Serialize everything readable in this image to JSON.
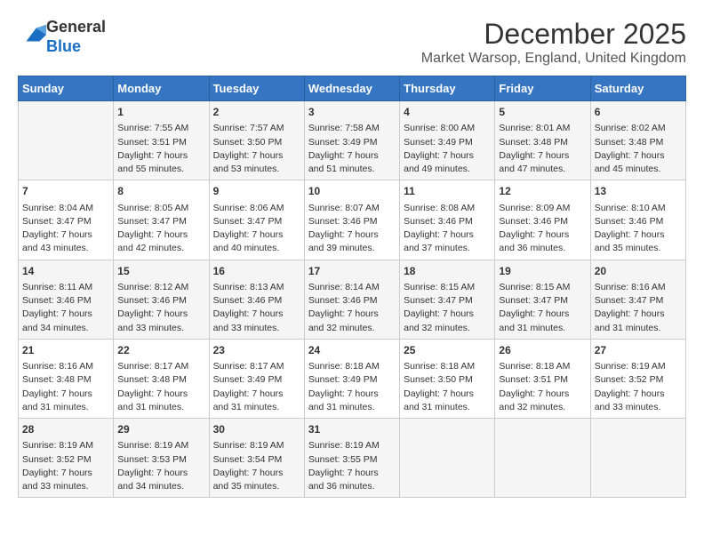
{
  "header": {
    "logo_line1": "General",
    "logo_line2": "Blue",
    "month_year": "December 2025",
    "location": "Market Warsop, England, United Kingdom"
  },
  "days_of_week": [
    "Sunday",
    "Monday",
    "Tuesday",
    "Wednesday",
    "Thursday",
    "Friday",
    "Saturday"
  ],
  "weeks": [
    [
      {
        "day": "",
        "content": ""
      },
      {
        "day": "1",
        "content": "Sunrise: 7:55 AM\nSunset: 3:51 PM\nDaylight: 7 hours\nand 55 minutes."
      },
      {
        "day": "2",
        "content": "Sunrise: 7:57 AM\nSunset: 3:50 PM\nDaylight: 7 hours\nand 53 minutes."
      },
      {
        "day": "3",
        "content": "Sunrise: 7:58 AM\nSunset: 3:49 PM\nDaylight: 7 hours\nand 51 minutes."
      },
      {
        "day": "4",
        "content": "Sunrise: 8:00 AM\nSunset: 3:49 PM\nDaylight: 7 hours\nand 49 minutes."
      },
      {
        "day": "5",
        "content": "Sunrise: 8:01 AM\nSunset: 3:48 PM\nDaylight: 7 hours\nand 47 minutes."
      },
      {
        "day": "6",
        "content": "Sunrise: 8:02 AM\nSunset: 3:48 PM\nDaylight: 7 hours\nand 45 minutes."
      }
    ],
    [
      {
        "day": "7",
        "content": "Sunrise: 8:04 AM\nSunset: 3:47 PM\nDaylight: 7 hours\nand 43 minutes."
      },
      {
        "day": "8",
        "content": "Sunrise: 8:05 AM\nSunset: 3:47 PM\nDaylight: 7 hours\nand 42 minutes."
      },
      {
        "day": "9",
        "content": "Sunrise: 8:06 AM\nSunset: 3:47 PM\nDaylight: 7 hours\nand 40 minutes."
      },
      {
        "day": "10",
        "content": "Sunrise: 8:07 AM\nSunset: 3:46 PM\nDaylight: 7 hours\nand 39 minutes."
      },
      {
        "day": "11",
        "content": "Sunrise: 8:08 AM\nSunset: 3:46 PM\nDaylight: 7 hours\nand 37 minutes."
      },
      {
        "day": "12",
        "content": "Sunrise: 8:09 AM\nSunset: 3:46 PM\nDaylight: 7 hours\nand 36 minutes."
      },
      {
        "day": "13",
        "content": "Sunrise: 8:10 AM\nSunset: 3:46 PM\nDaylight: 7 hours\nand 35 minutes."
      }
    ],
    [
      {
        "day": "14",
        "content": "Sunrise: 8:11 AM\nSunset: 3:46 PM\nDaylight: 7 hours\nand 34 minutes."
      },
      {
        "day": "15",
        "content": "Sunrise: 8:12 AM\nSunset: 3:46 PM\nDaylight: 7 hours\nand 33 minutes."
      },
      {
        "day": "16",
        "content": "Sunrise: 8:13 AM\nSunset: 3:46 PM\nDaylight: 7 hours\nand 33 minutes."
      },
      {
        "day": "17",
        "content": "Sunrise: 8:14 AM\nSunset: 3:46 PM\nDaylight: 7 hours\nand 32 minutes."
      },
      {
        "day": "18",
        "content": "Sunrise: 8:15 AM\nSunset: 3:47 PM\nDaylight: 7 hours\nand 32 minutes."
      },
      {
        "day": "19",
        "content": "Sunrise: 8:15 AM\nSunset: 3:47 PM\nDaylight: 7 hours\nand 31 minutes."
      },
      {
        "day": "20",
        "content": "Sunrise: 8:16 AM\nSunset: 3:47 PM\nDaylight: 7 hours\nand 31 minutes."
      }
    ],
    [
      {
        "day": "21",
        "content": "Sunrise: 8:16 AM\nSunset: 3:48 PM\nDaylight: 7 hours\nand 31 minutes."
      },
      {
        "day": "22",
        "content": "Sunrise: 8:17 AM\nSunset: 3:48 PM\nDaylight: 7 hours\nand 31 minutes."
      },
      {
        "day": "23",
        "content": "Sunrise: 8:17 AM\nSunset: 3:49 PM\nDaylight: 7 hours\nand 31 minutes."
      },
      {
        "day": "24",
        "content": "Sunrise: 8:18 AM\nSunset: 3:49 PM\nDaylight: 7 hours\nand 31 minutes."
      },
      {
        "day": "25",
        "content": "Sunrise: 8:18 AM\nSunset: 3:50 PM\nDaylight: 7 hours\nand 31 minutes."
      },
      {
        "day": "26",
        "content": "Sunrise: 8:18 AM\nSunset: 3:51 PM\nDaylight: 7 hours\nand 32 minutes."
      },
      {
        "day": "27",
        "content": "Sunrise: 8:19 AM\nSunset: 3:52 PM\nDaylight: 7 hours\nand 33 minutes."
      }
    ],
    [
      {
        "day": "28",
        "content": "Sunrise: 8:19 AM\nSunset: 3:52 PM\nDaylight: 7 hours\nand 33 minutes."
      },
      {
        "day": "29",
        "content": "Sunrise: 8:19 AM\nSunset: 3:53 PM\nDaylight: 7 hours\nand 34 minutes."
      },
      {
        "day": "30",
        "content": "Sunrise: 8:19 AM\nSunset: 3:54 PM\nDaylight: 7 hours\nand 35 minutes."
      },
      {
        "day": "31",
        "content": "Sunrise: 8:19 AM\nSunset: 3:55 PM\nDaylight: 7 hours\nand 36 minutes."
      },
      {
        "day": "",
        "content": ""
      },
      {
        "day": "",
        "content": ""
      },
      {
        "day": "",
        "content": ""
      }
    ]
  ]
}
